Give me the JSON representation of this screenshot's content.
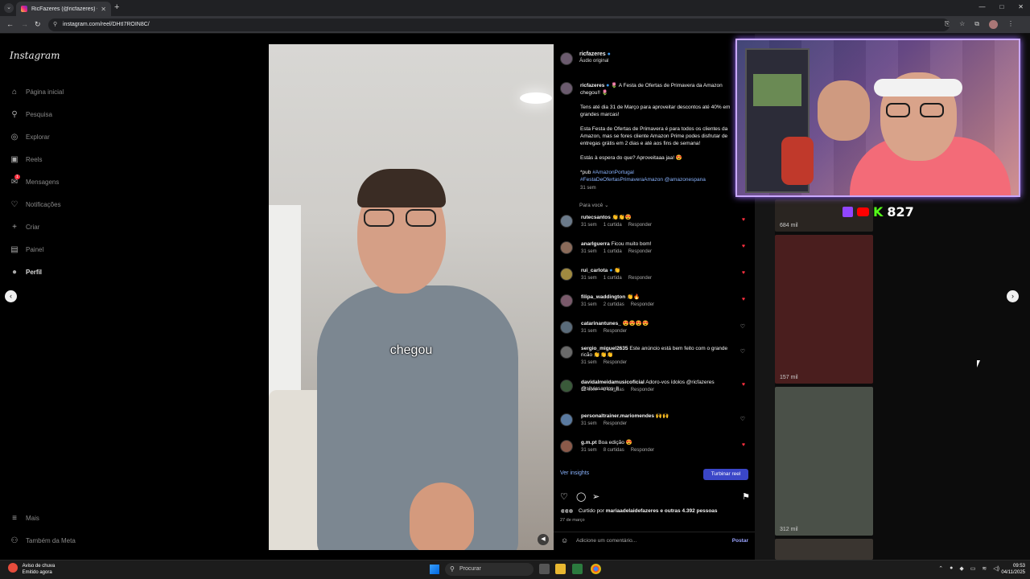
{
  "browser": {
    "tab_title": "RicFazeres (@ricfazeres) • I",
    "url": "instagram.com/reel/DHtI7ROIN8C/"
  },
  "sidebar": {
    "logo": "Instagram",
    "items": [
      {
        "label": "Página inicial",
        "icon": "home-icon"
      },
      {
        "label": "Pesquisa",
        "icon": "search-icon"
      },
      {
        "label": "Explorar",
        "icon": "compass-icon"
      },
      {
        "label": "Reels",
        "icon": "reels-icon"
      },
      {
        "label": "Mensagens",
        "icon": "messenger-icon",
        "badge": "1"
      },
      {
        "label": "Notificações",
        "icon": "heart-icon"
      },
      {
        "label": "Criar",
        "icon": "plus-icon"
      },
      {
        "label": "Painel",
        "icon": "dashboard-icon"
      },
      {
        "label": "Perfil",
        "icon": "avatar"
      }
    ],
    "bottom": [
      {
        "label": "Mais",
        "icon": "menu-icon"
      },
      {
        "label": "Também da Meta",
        "icon": "meta-icon"
      }
    ]
  },
  "video": {
    "caption": "chegou"
  },
  "post": {
    "author": "ricfazeres",
    "audio": "Áudio original",
    "caption_author": "ricfazeres",
    "caption_line1": "🌷 A Festa de Ofertas de Primavera da Amazon chegou!! 🌷",
    "caption_p2": "Tens até dia 31 de Março para aproveitar descontos até 40% em grandes marcas!",
    "caption_p3": "Esta Festa de Ofertas de Primavera é para todos os clientes da Amazon, mas se fores cliente Amazon Prime podes disfrutar de entregas grátis em 2 dias e até aos fins de semana!",
    "caption_p4": "Estás à espera do que? Aproveitaaa jaa! 😍",
    "caption_pub": "*pub",
    "caption_tag1": "#AmazonPortugal",
    "caption_tags": "#FestaDeOfertasPrimaveraAmazon @amazonespana",
    "caption_time": "31 sem",
    "sort_label": "Para você"
  },
  "comments": [
    {
      "user": "rutecsantos",
      "text": "👏👏😍",
      "time": "31 sem",
      "likes": "1 curtida",
      "reply": "Responder",
      "liked": true
    },
    {
      "user": "anarlguerra",
      "text": "Ficou muito bom!",
      "time": "31 sem",
      "likes": "1 curtida",
      "reply": "Responder",
      "liked": true
    },
    {
      "user": "rui_carlota",
      "text": "👏",
      "time": "31 sem",
      "likes": "1 curtida",
      "reply": "Responder",
      "liked": true,
      "verified": true
    },
    {
      "user": "filipa_waddington",
      "text": "👏🔥",
      "time": "31 sem",
      "likes": "2 curtidas",
      "reply": "Responder",
      "liked": true
    },
    {
      "user": "catarinantunes_",
      "text": "😍😍😍😍",
      "time": "31 sem",
      "likes": "",
      "reply": "Responder",
      "liked": false
    },
    {
      "user": "sergio_miguel2635",
      "text": "Este anúncio está bem feito com o grande ricão 👏👏👏",
      "time": "31 sem",
      "likes": "",
      "reply": "Responder",
      "liked": false
    },
    {
      "user": "davidalmeidamusicoficial",
      "text": "Adoro-vos ídolos @ricfazeres @silviasantos_ll",
      "time": "31 sem",
      "likes": "2 curtidas",
      "reply": "Responder",
      "liked": true
    },
    {
      "user": "personaltrainer.mariomendes",
      "text": "🙌🙌",
      "time": "31 sem",
      "likes": "",
      "reply": "Responder",
      "liked": false
    },
    {
      "user": "g.m.pt",
      "text": "Boa edição 😍",
      "time": "31 sem",
      "likes": "8 curtidas",
      "reply": "Responder",
      "liked": true
    }
  ],
  "footer": {
    "insights": "Ver insights",
    "boost": "Turbinar reel",
    "liked_by_prefix": "Curtido por",
    "liked_by_user": "mariaadelaidefazeres",
    "liked_by_suffix": "e outras 4.392 pessoas",
    "date": "27 de março",
    "add_comment_placeholder": "Adicione um comentário...",
    "post_label": "Postar"
  },
  "background_grid": {
    "views": [
      "684 mil",
      "157 mil",
      "312 mil"
    ]
  },
  "overlay": {
    "viewer_count": "827",
    "platforms": [
      "twitch-icon",
      "youtube-icon",
      "kick-icon"
    ]
  },
  "taskbar": {
    "weather_title": "Aviso de chuva",
    "weather_sub": "Emitido agora",
    "search_label": "Procurar",
    "time": "09:53",
    "date": "04/11/2025"
  },
  "colors": {
    "accent_link": "#8ab4ff",
    "like_red": "#ff3040",
    "boost_button": "#3a46c8",
    "cam_border": "#c9a8ff"
  }
}
